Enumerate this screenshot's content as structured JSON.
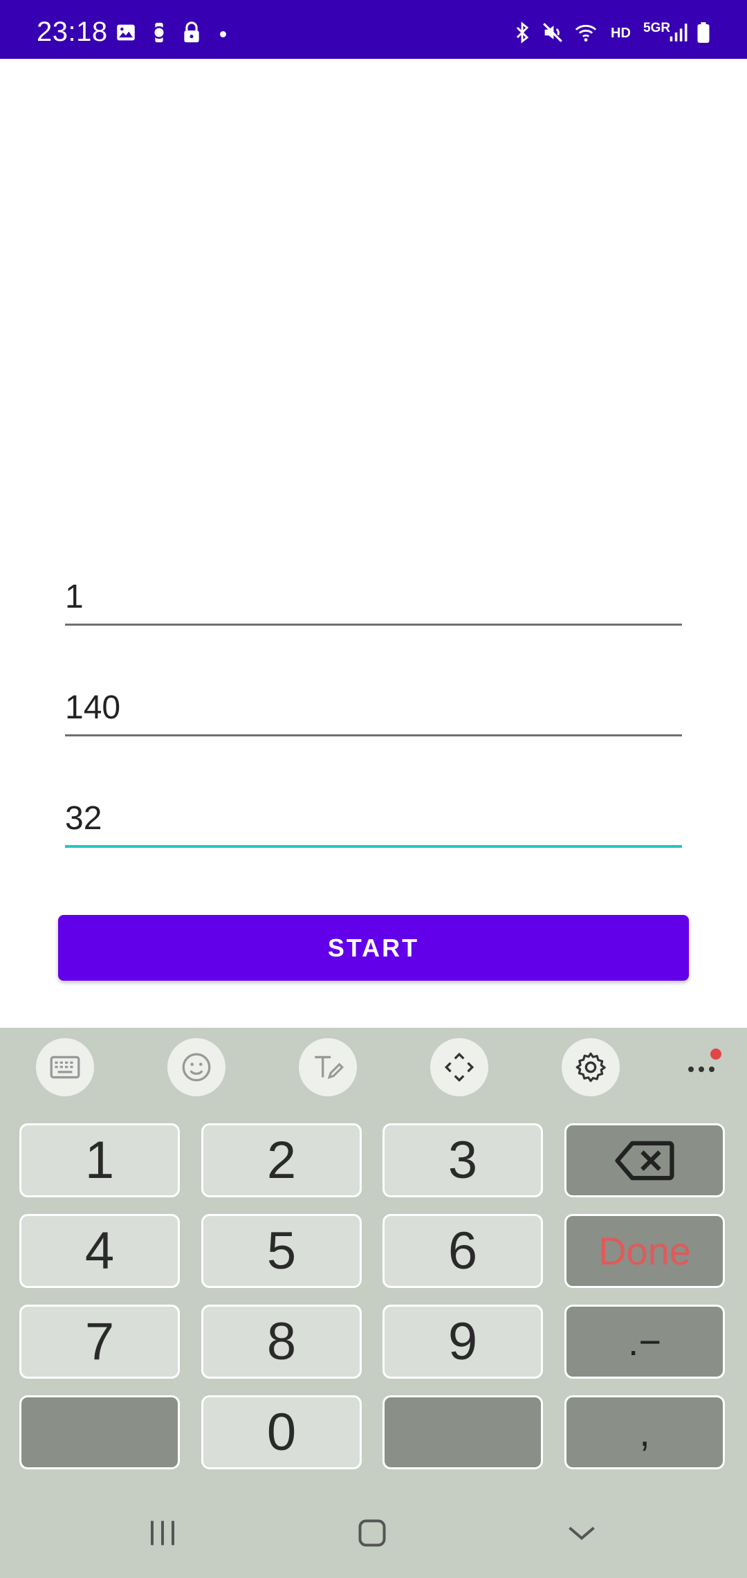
{
  "status_bar": {
    "time": "23:18",
    "left_icons": [
      "image-icon",
      "watch-icon",
      "lock-icon",
      "dot-icon"
    ],
    "right_icons": [
      "bluetooth-icon",
      "mute-icon",
      "wifi-icon",
      "hd-label",
      "5g-signal-icon",
      "battery-icon"
    ],
    "hd_label": "HD",
    "network_label": "5GR"
  },
  "form": {
    "fields": [
      {
        "value": "1"
      },
      {
        "value": "140"
      },
      {
        "value": "32",
        "focused": true
      }
    ],
    "start_label": "START"
  },
  "keyboard": {
    "toolbar": [
      "keyboard-icon",
      "emoji-icon",
      "handwriting-icon",
      "move-keyboard-icon",
      "settings-icon",
      "more-icon"
    ],
    "keys": {
      "k1": "1",
      "k2": "2",
      "k3": "3",
      "k4": "4",
      "k5": "5",
      "k6": "6",
      "k7": "7",
      "k8": "8",
      "k9": "9",
      "k0": "0",
      "done": "Done",
      "dot_minus": ".−",
      "comma": ","
    }
  },
  "nav_bar": [
    "recent-apps-icon",
    "home-icon",
    "back-icon"
  ],
  "colors": {
    "status_bar": "#3700b3",
    "button": "#6200ea",
    "focus_line": "#26c6c0",
    "keyboard_bg": "#c6cdc3"
  }
}
